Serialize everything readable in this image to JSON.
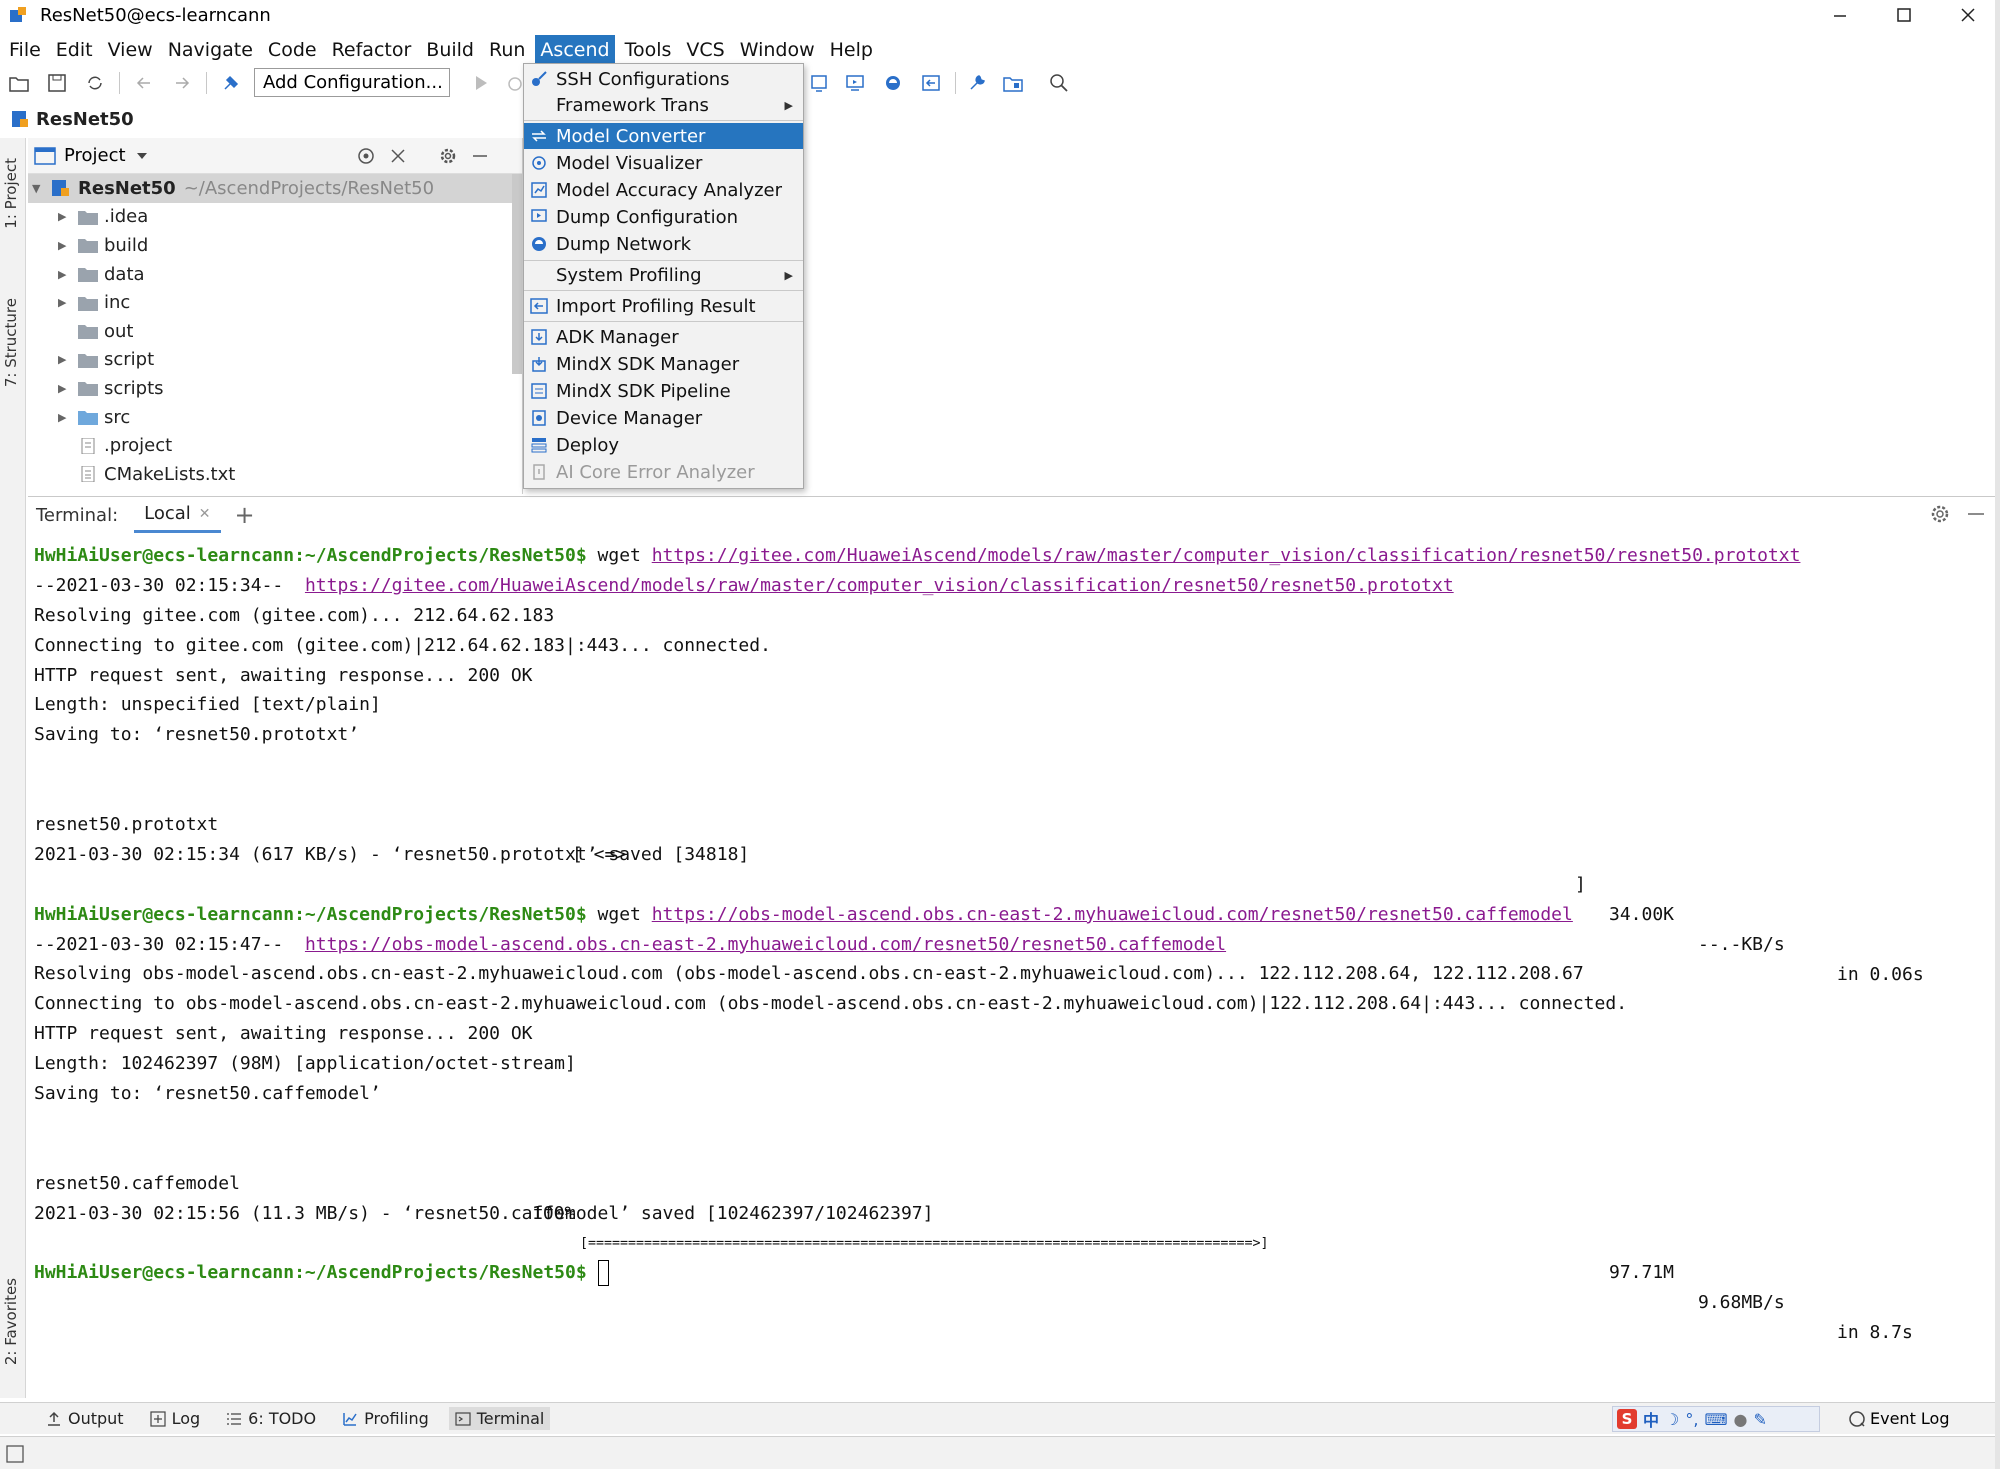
{
  "window": {
    "title": "ResNet50@ecs-learncann"
  },
  "menubar": {
    "items": [
      "File",
      "Edit",
      "View",
      "Navigate",
      "Code",
      "Refactor",
      "Build",
      "Run",
      "Ascend",
      "Tools",
      "VCS",
      "Window",
      "Help"
    ],
    "active": "Ascend"
  },
  "toolbar": {
    "add_configuration": "Add Configuration..."
  },
  "navbar": {
    "project_name": "ResNet50"
  },
  "side_tabs": {
    "project": "1: Project",
    "structure": "7: Structure",
    "favorites": "2: Favorites"
  },
  "project_panel": {
    "title": "Project",
    "root": {
      "name": "ResNet50",
      "path": "~/AscendProjects/ResNet50"
    },
    "items": [
      {
        "name": ".idea",
        "kind": "folder",
        "expandable": true
      },
      {
        "name": "build",
        "kind": "folder",
        "expandable": true
      },
      {
        "name": "data",
        "kind": "folder",
        "expandable": true
      },
      {
        "name": "inc",
        "kind": "folder",
        "expandable": true
      },
      {
        "name": "out",
        "kind": "folder",
        "expandable": false
      },
      {
        "name": "script",
        "kind": "folder",
        "expandable": true
      },
      {
        "name": "scripts",
        "kind": "folder",
        "expandable": true
      },
      {
        "name": "src",
        "kind": "folder-src",
        "expandable": true
      },
      {
        "name": ".project",
        "kind": "file",
        "expandable": false
      },
      {
        "name": "CMakeLists.txt",
        "kind": "file",
        "expandable": false
      }
    ]
  },
  "ascend_menu": {
    "items": [
      {
        "label": "SSH Configurations",
        "submenu": false,
        "state": "normal"
      },
      {
        "label": "Framework Trans",
        "submenu": true,
        "state": "normal"
      },
      {
        "label": "Model Converter",
        "submenu": false,
        "state": "highlighted"
      },
      {
        "label": "Model Visualizer",
        "submenu": false,
        "state": "normal"
      },
      {
        "label": "Model Accuracy Analyzer",
        "submenu": false,
        "state": "normal"
      },
      {
        "label": "Dump Configuration",
        "submenu": false,
        "state": "normal"
      },
      {
        "label": "Dump Network",
        "submenu": false,
        "state": "normal"
      },
      {
        "label": "System Profiling",
        "submenu": true,
        "state": "normal"
      },
      {
        "label": "Import Profiling Result",
        "submenu": false,
        "state": "normal"
      },
      {
        "label": "ADK Manager",
        "submenu": false,
        "state": "normal"
      },
      {
        "label": "MindX SDK Manager",
        "submenu": false,
        "state": "normal"
      },
      {
        "label": "MindX SDK Pipeline",
        "submenu": false,
        "state": "normal"
      },
      {
        "label": "Device Manager",
        "submenu": false,
        "state": "normal"
      },
      {
        "label": "Deploy",
        "submenu": false,
        "state": "normal"
      },
      {
        "label": "AI Core Error Analyzer",
        "submenu": false,
        "state": "disabled"
      }
    ]
  },
  "terminal": {
    "label": "Terminal:",
    "tab": "Local",
    "prompt": "HwHiAiUser@ecs-learncann:~/AscendProjects/ResNet50$",
    "cmd1": " wget ",
    "url1": "https://gitee.com/HuaweiAscend/models/raw/master/computer_vision/classification/resnet50/resnet50.prototxt",
    "l2_prefix": "--2021-03-30 02:15:34--  ",
    "l3": "Resolving gitee.com (gitee.com)... 212.64.62.183",
    "l4": "Connecting to gitee.com (gitee.com)|212.64.62.183|:443... connected.",
    "l5": "HTTP request sent, awaiting response... 200 OK",
    "l6": "Length: unspecified [text/plain]",
    "l7": "Saving to: ‘resnet50.prototxt’",
    "p1_name": "resnet50.prototxt",
    "p1_bar": "[ <=>",
    "p1_end": "]",
    "p1_size": "34.00K",
    "p1_speed": "--.-KB/s",
    "p1_time": "in 0.06s",
    "l10": "2021-03-30 02:15:34 (617 KB/s) - ‘resnet50.prototxt’ saved [34818]",
    "url2": "https://obs-model-ascend.obs.cn-east-2.myhuaweicloud.com/resnet50/resnet50.caffemodel",
    "l13_prefix": "--2021-03-30 02:15:47--  ",
    "l14": "Resolving obs-model-ascend.obs.cn-east-2.myhuaweicloud.com (obs-model-ascend.obs.cn-east-2.myhuaweicloud.com)... 122.112.208.64, 122.112.208.67",
    "l15": "Connecting to obs-model-ascend.obs.cn-east-2.myhuaweicloud.com (obs-model-ascend.obs.cn-east-2.myhuaweicloud.com)|122.112.208.64|:443... connected.",
    "l16": "HTTP request sent, awaiting response... 200 OK",
    "l17": "Length: 102462397 (98M) [application/octet-stream]",
    "l18": "Saving to: ‘resnet50.caffemodel’",
    "p2_name": "resnet50.caffemodel",
    "p2_pct": "100%",
    "p2_bar": "[===================================================================================>]",
    "p2_size": "97.71M",
    "p2_speed": "9.68MB/s",
    "p2_time": "in 8.7s",
    "l21": "2021-03-30 02:15:56 (11.3 MB/s) - ‘resnet50.caffemodel’ saved [102462397/102462397]"
  },
  "bottom_tabs": {
    "output": "Output",
    "log": "Log",
    "todo": "6: TODO",
    "profiling": "Profiling",
    "terminal": "Terminal",
    "event_log": "Event Log"
  },
  "ime": {
    "lang": "中"
  },
  "colors": {
    "accent": "#2675bf",
    "prompt": "#2d8a14",
    "link": "#8a1a8f"
  }
}
